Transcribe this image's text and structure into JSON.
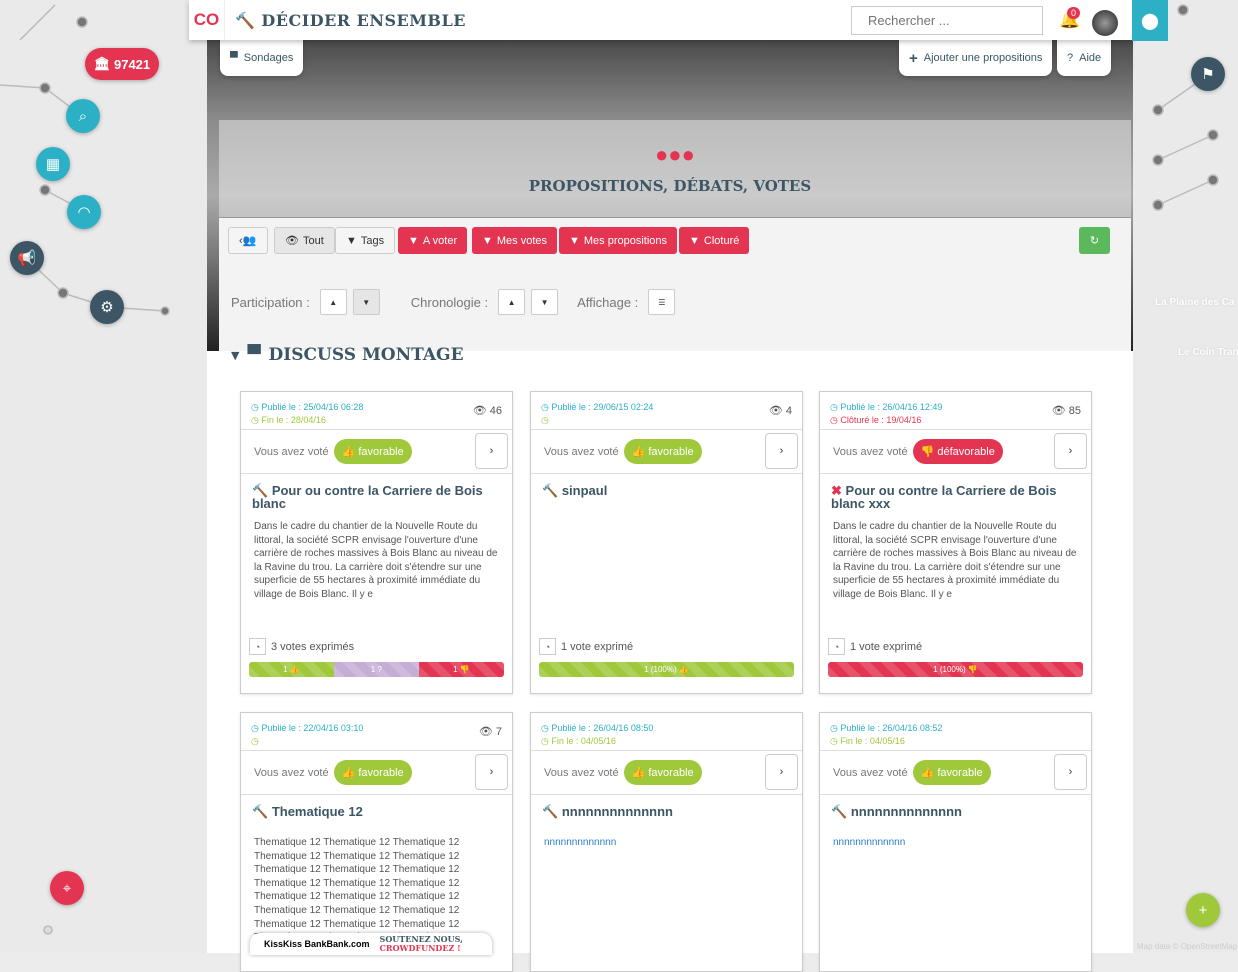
{
  "header": {
    "logo": "CO",
    "brand": "DÉCIDER ENSEMBLE",
    "search_placeholder": "Rechercher ...",
    "notifications": "0"
  },
  "left_map": {
    "postal_code": "97421"
  },
  "right_map": {
    "labels": [
      "La Plaine des Ca",
      "Le Coin Tran"
    ],
    "attribution": "Map data © OpenStreetMap"
  },
  "tabs": {
    "sondages": "Sondages",
    "add": "Ajouter une propositions",
    "help": "Aide"
  },
  "hero": {
    "title": "PROPOSITIONS, DÉBATS, VOTES"
  },
  "filters": {
    "all": "Tout",
    "tags": "Tags",
    "to_vote": "A voter",
    "my_votes": "Mes votes",
    "my_props": "Mes propositions",
    "closed": "Cloturé"
  },
  "sorting": {
    "participation": "Participation :",
    "chronology": "Chronologie :",
    "display": "Affichage :"
  },
  "section": {
    "title": "DISCUSS MONTAGE"
  },
  "cards": [
    {
      "published": "Publié le : 25/04/16 06:28",
      "end": "Fin le : 28/04/16",
      "views": "46",
      "voted_label": "Vous avez voté",
      "vote": "favorable",
      "title": "Pour ou contre la Carriere de Bois blanc",
      "desc": "Dans le cadre du chantier de la Nouvelle Route du littoral, la société SCPR envisage l'ouverture d'une carrière de roches massives à Bois Blanc au niveau de la Ravine du trou. La carrière doit s'étendre sur une superficie de 55 hectares à proximité immédiate du village de Bois Blanc. Il y e",
      "votes_count": "3 votes exprimés",
      "bar": [
        {
          "label": "1",
          "share": 33.3
        },
        {
          "label": "1",
          "share": 33.3
        },
        {
          "label": "1",
          "share": 33.4
        }
      ]
    },
    {
      "published": "Publié le : 29/06/15 02:24",
      "end": "",
      "views": "4",
      "voted_label": "Vous avez voté",
      "vote": "favorable",
      "title": "sinpaul",
      "desc": "",
      "votes_count": "1 vote exprimé",
      "bar": [
        {
          "label": "1 (100%)",
          "share": 100
        }
      ]
    },
    {
      "published": "Publié le : 26/04/16 12:49",
      "end": "Clôturé le : 19/04/16",
      "views": "85",
      "voted_label": "Vous avez voté",
      "vote": "défavorable",
      "title": "Pour ou contre la Carriere de Bois blanc xxx",
      "desc": "Dans le cadre du chantier de la Nouvelle Route du littoral, la société SCPR envisage l'ouverture d'une carrière de roches massives à Bois Blanc au niveau de la Ravine du trou. La carrière doit s'étendre sur une superficie de 55 hectares à proximité immédiate du village de Bois Blanc. Il y e",
      "votes_count": "1 vote exprimé",
      "bar": [
        {
          "label": "1 (100%)",
          "share": 100
        }
      ]
    },
    {
      "published": "Publié le : 22/04/16 03:10",
      "end": "",
      "views": "7",
      "voted_label": "Vous avez voté",
      "vote": "favorable",
      "title": "Thematique 12",
      "desc": "Thematique 12 Thematique 12 Thematique 12 Thematique 12 Thematique 12 Thematique 12 Thematique 12 Thematique 12 Thematique 12 Thematique 12 Thematique 12 Thematique 12 Thematique 12 Thematique 12 Thematique 12 Thematique 12 Thematique 12 Thematique 12 Thematique 12 Thematique 12 Thematique 12 Thematique 12 Thematique 12 Thematique 12"
    },
    {
      "published": "Publié le : 26/04/16 08:50",
      "end": "Fin le : 04/05/16",
      "views": "",
      "voted_label": "Vous avez voté",
      "vote": "favorable",
      "title": "nnnnnnnnnnnnnn",
      "desc": "nnnnnnnnnnnnn"
    },
    {
      "published": "Publié le : 26/04/16 08:52",
      "end": "Fin le : 04/05/16",
      "views": "",
      "voted_label": "Vous avez voté",
      "vote": "favorable",
      "title": "nnnnnnnnnnnnnn",
      "desc": "nnnnnnnnnnnnn"
    }
  ],
  "banner": {
    "brand": "KissKiss BankBank.com",
    "text1": "SOUTENEZ NOUS,",
    "text2": "CROWDFUNDEZ !"
  },
  "colors": {
    "red": "#e33551",
    "teal": "#2bb0c6",
    "green": "#9fc83b",
    "purple": "#c5aed6",
    "navy": "#3c5665"
  }
}
